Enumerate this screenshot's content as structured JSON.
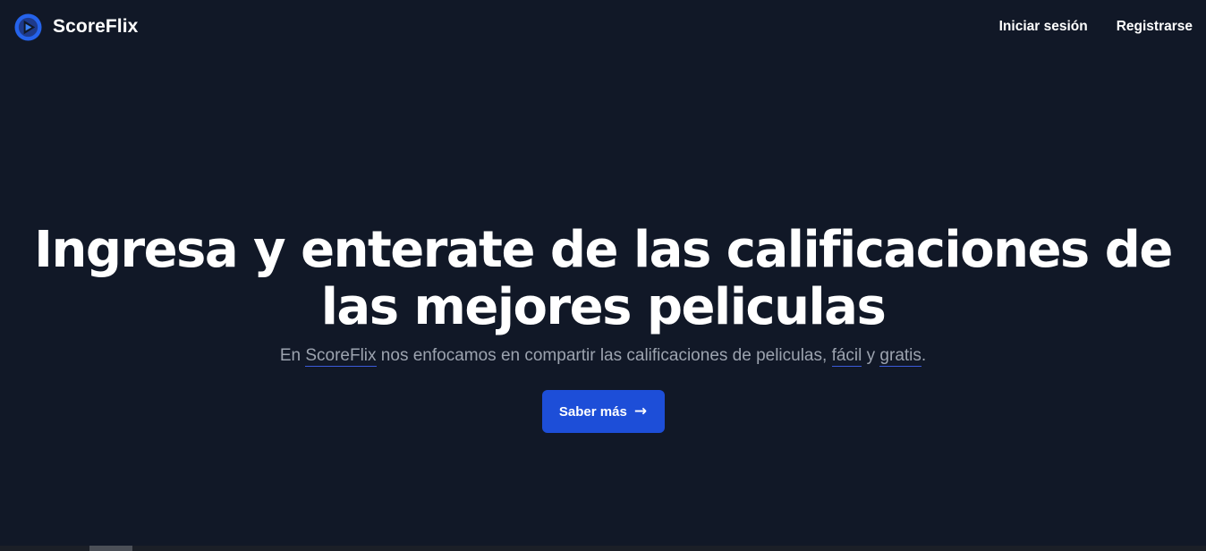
{
  "header": {
    "brand_name": "ScoreFlix",
    "logo_icon": "play-logo-icon",
    "nav": {
      "login_label": "Iniciar sesión",
      "register_label": "Registrarse"
    }
  },
  "hero": {
    "headline": "Ingresa y enterate de las calificaciones de las mejores peliculas",
    "subtitle": {
      "prefix": "En ",
      "brand_link": "ScoreFlix",
      "middle": " nos enfocamos en compartir las calificaciones de peliculas, ",
      "easy_link": "fácil",
      "connector": " y ",
      "free_link": "gratis",
      "suffix": "."
    },
    "cta_label": "Saber más",
    "cta_icon": "arrow-right-icon"
  },
  "colors": {
    "background": "#111827",
    "accent": "#1d4ed8",
    "subtitle_text": "#9ca3af",
    "link_underline": "#3b5bdb"
  }
}
